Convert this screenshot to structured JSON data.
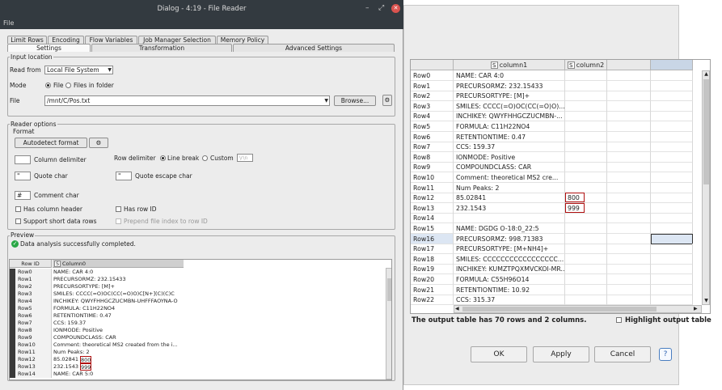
{
  "dialog": {
    "title": "Dialog - 4:19 - File Reader",
    "menu": "File",
    "tabs_top": [
      "Limit Rows",
      "Encoding",
      "Flow Variables",
      "Job Manager Selection",
      "Memory Policy"
    ],
    "tabs_bottom": [
      "Settings",
      "Transformation",
      "Advanced Settings"
    ]
  },
  "input_location": {
    "group_label": "Input location",
    "read_from_label": "Read from",
    "read_from_value": "Local File System",
    "mode_label": "Mode",
    "mode_file": "File",
    "mode_folder": "Files in folder",
    "file_label": "File",
    "file_value": "/mnt/C/Pos.txt",
    "browse_label": "Browse..."
  },
  "reader_options": {
    "group_label": "Reader options",
    "format_label": "Format",
    "autodetect_label": "Autodetect format",
    "column_delimiter_label": "Column delimiter",
    "column_delimiter_value": "",
    "row_delimiter_label": "Row delimiter",
    "line_break_label": "Line break",
    "custom_label": "Custom",
    "custom_value": "\\r\\n",
    "quote_char_label": "Quote char",
    "quote_char_value": "\"",
    "quote_escape_label": "Quote escape char",
    "quote_escape_value": "\"",
    "comment_char_label": "Comment char",
    "comment_char_value": "#",
    "has_column_header": "Has column header",
    "has_row_id": "Has row ID",
    "support_short": "Support short data rows",
    "prepend_file_index": "Prepend file index to row ID"
  },
  "preview": {
    "group_label": "Preview",
    "status": "Data analysis successfully completed.",
    "header_rowid": "Row ID",
    "header_col": "Column0",
    "col_type": "S",
    "rows": [
      {
        "id": "Row0",
        "val": "NAME: CAR 4:0"
      },
      {
        "id": "Row1",
        "val": "PRECURSORMZ: 232.15433"
      },
      {
        "id": "Row2",
        "val": "PRECURSORTYPE: [M]+"
      },
      {
        "id": "Row3",
        "val": "SMILES: CCCC(=O)OC(CC(=O)O)C[N+](C)(C)C"
      },
      {
        "id": "Row4",
        "val": "INCHIKEY: QWYFHHGCZUCMBN-UHFFFAOYNA-O"
      },
      {
        "id": "Row5",
        "val": "FORMULA: C11H22NO4"
      },
      {
        "id": "Row6",
        "val": "RETENTIONTIME: 0.47"
      },
      {
        "id": "Row7",
        "val": "CCS: 159.37"
      },
      {
        "id": "Row8",
        "val": "IONMODE: Positive"
      },
      {
        "id": "Row9",
        "val": "COMPOUNDCLASS: CAR"
      },
      {
        "id": "Row10",
        "val": "Comment: theoretical MS2 created from the i..."
      },
      {
        "id": "Row11",
        "val": "Num Peaks: 2"
      },
      {
        "id": "Row12",
        "val": "85.02841",
        "extra": "800"
      },
      {
        "id": "Row13",
        "val": "232.1543",
        "extra": "999"
      },
      {
        "id": "Row14",
        "val": "NAME: CAR 5:0"
      }
    ]
  },
  "output": {
    "col_type": "S",
    "col1": "column1",
    "col2": "column2",
    "rows": [
      {
        "id": "Row0",
        "c1": "NAME: CAR 4:0",
        "c2": ""
      },
      {
        "id": "Row1",
        "c1": "PRECURSORMZ: 232.15433",
        "c2": ""
      },
      {
        "id": "Row2",
        "c1": "PRECURSORTYPE: [M]+",
        "c2": ""
      },
      {
        "id": "Row3",
        "c1": "SMILES: CCCC(=O)OC(CC(=O)O)...",
        "c2": ""
      },
      {
        "id": "Row4",
        "c1": "INCHIKEY: QWYFHHGCZUCMBN-...",
        "c2": ""
      },
      {
        "id": "Row5",
        "c1": "FORMULA: C11H22NO4",
        "c2": ""
      },
      {
        "id": "Row6",
        "c1": "RETENTIONTIME: 0.47",
        "c2": ""
      },
      {
        "id": "Row7",
        "c1": "CCS: 159.37",
        "c2": ""
      },
      {
        "id": "Row8",
        "c1": "IONMODE: Positive",
        "c2": ""
      },
      {
        "id": "Row9",
        "c1": "COMPOUNDCLASS: CAR",
        "c2": ""
      },
      {
        "id": "Row10",
        "c1": "Comment: theoretical MS2 cre...",
        "c2": ""
      },
      {
        "id": "Row11",
        "c1": "Num Peaks: 2",
        "c2": ""
      },
      {
        "id": "Row12",
        "c1": "85.02841",
        "c2": "800"
      },
      {
        "id": "Row13",
        "c1": "232.1543",
        "c2": "999"
      },
      {
        "id": "Row14",
        "c1": "",
        "c2": ""
      },
      {
        "id": "Row15",
        "c1": "NAME: DGDG O-18:0_22:5",
        "c2": ""
      },
      {
        "id": "Row16",
        "c1": "PRECURSORMZ: 998.71383",
        "c2": ""
      },
      {
        "id": "Row17",
        "c1": "PRECURSORTYPE: [M+NH4]+",
        "c2": ""
      },
      {
        "id": "Row18",
        "c1": "SMILES: CCCCCCCCCCCCCCCCC...",
        "c2": ""
      },
      {
        "id": "Row19",
        "c1": "INCHIKEY: KUMZTPQXMVCKOI-MR...",
        "c2": ""
      },
      {
        "id": "Row20",
        "c1": "FORMULA: C55H96O14",
        "c2": ""
      },
      {
        "id": "Row21",
        "c1": "RETENTIONTIME: 10.92",
        "c2": ""
      },
      {
        "id": "Row22",
        "c1": "CCS: 315.37",
        "c2": ""
      }
    ],
    "summary": "The output table has 70 rows and 2 columns.",
    "highlight_label": "Highlight output table"
  },
  "footer": {
    "ok": "OK",
    "apply": "Apply",
    "cancel": "Cancel",
    "help": "?"
  }
}
